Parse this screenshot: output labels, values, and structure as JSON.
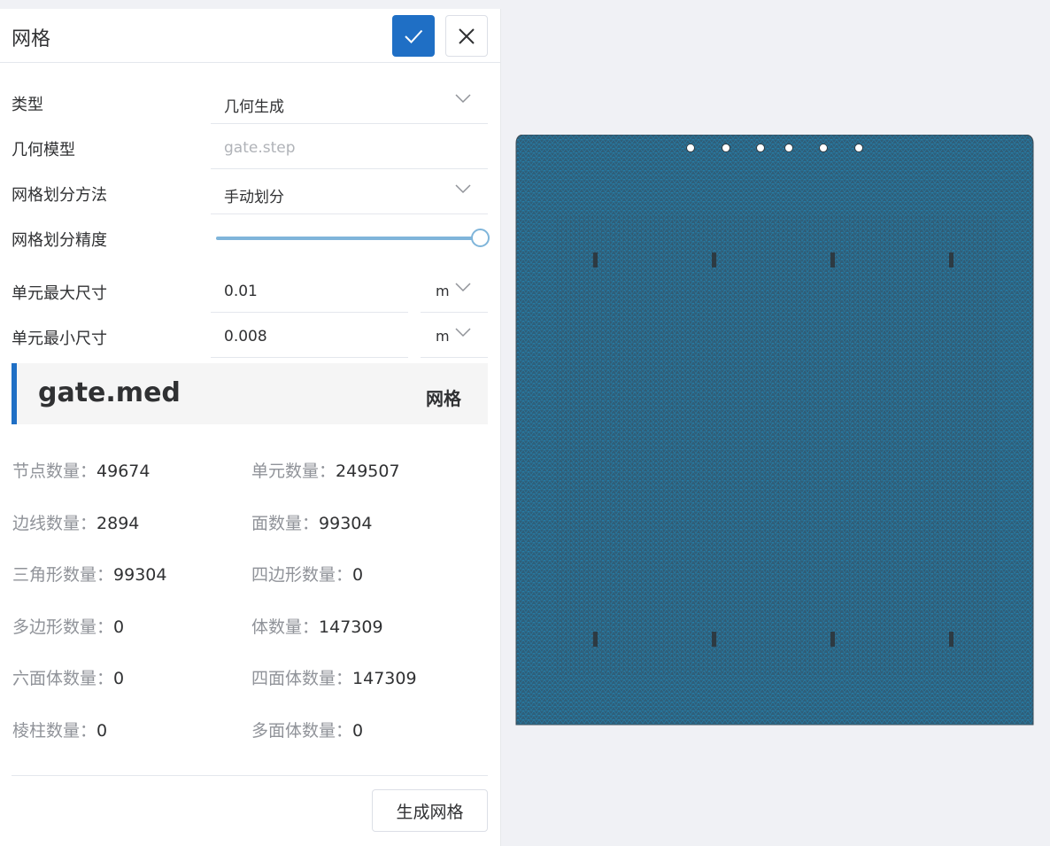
{
  "panel": {
    "title": "网格",
    "confirm_icon": "check-icon",
    "close_icon": "close-icon"
  },
  "form": {
    "type": {
      "label": "类型",
      "value": "几何生成"
    },
    "geometry": {
      "label": "几何模型",
      "placeholder": "gate.step"
    },
    "method": {
      "label": "网格划分方法",
      "value": "手动划分"
    },
    "precision": {
      "label": "网格划分精度",
      "level": 1.0
    },
    "max_size": {
      "label": "单元最大尺寸",
      "value": "0.01",
      "unit": "m"
    },
    "min_size": {
      "label": "单元最小尺寸",
      "value": "0.008",
      "unit": "m"
    }
  },
  "mesh_file": {
    "name": "gate.med",
    "type": "网格"
  },
  "stats": [
    {
      "label": "节点数量：",
      "value": "49674"
    },
    {
      "label": "单元数量：",
      "value": "249507"
    },
    {
      "label": "边线数量：",
      "value": "2894"
    },
    {
      "label": "面数量：",
      "value": "99304"
    },
    {
      "label": "三角形数量：",
      "value": "99304"
    },
    {
      "label": "四边形数量：",
      "value": "0"
    },
    {
      "label": "多边形数量：",
      "value": "0"
    },
    {
      "label": "体数量：",
      "value": "147309"
    },
    {
      "label": "六面体数量：",
      "value": "0"
    },
    {
      "label": "四面体数量：",
      "value": "147309"
    },
    {
      "label": "棱柱数量：",
      "value": "0"
    },
    {
      "label": "多面体数量：",
      "value": "0"
    }
  ],
  "actions": {
    "generate_label": "生成网格"
  },
  "colors": {
    "accent": "#1f6fc5",
    "slider": "#7fb5da",
    "mesh_fill": "#2f5f7a",
    "mesh_edge": "#1aa3e0"
  }
}
